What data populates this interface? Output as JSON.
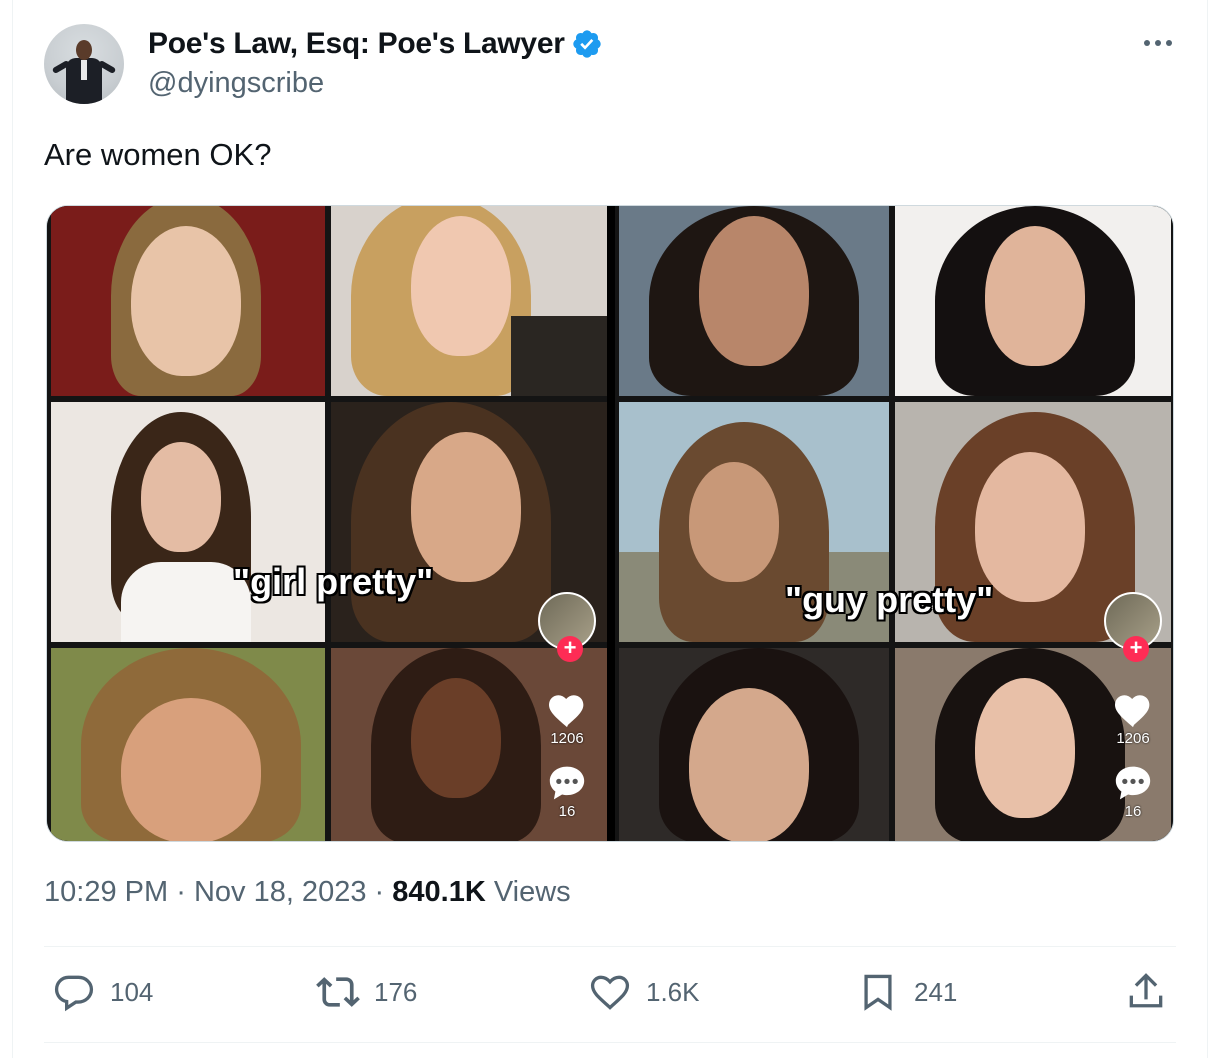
{
  "author": {
    "display_name": "Poe's Law, Esq: Poe's Lawyer",
    "handle": "@dyingscribe",
    "verified_color": "#1d9bf0"
  },
  "tweet": {
    "text": "Are women OK?"
  },
  "media": {
    "left_caption": "\"girl pretty\"",
    "right_caption": "\"guy pretty\"",
    "left_likes": "1206",
    "left_comments": "16",
    "right_likes": "1206",
    "right_comments": "16"
  },
  "meta": {
    "time": "10:29 PM",
    "date": "Nov 18, 2023",
    "views_count": "840.1K",
    "views_label": "Views",
    "separator": "·"
  },
  "actions": {
    "replies": "104",
    "retweets": "176",
    "likes": "1.6K",
    "bookmarks": "241"
  },
  "icons": {
    "more": "more-horizontal-icon",
    "reply": "reply-icon",
    "retweet": "retweet-icon",
    "like": "heart-icon",
    "bookmark": "bookmark-icon",
    "share": "share-icon"
  }
}
